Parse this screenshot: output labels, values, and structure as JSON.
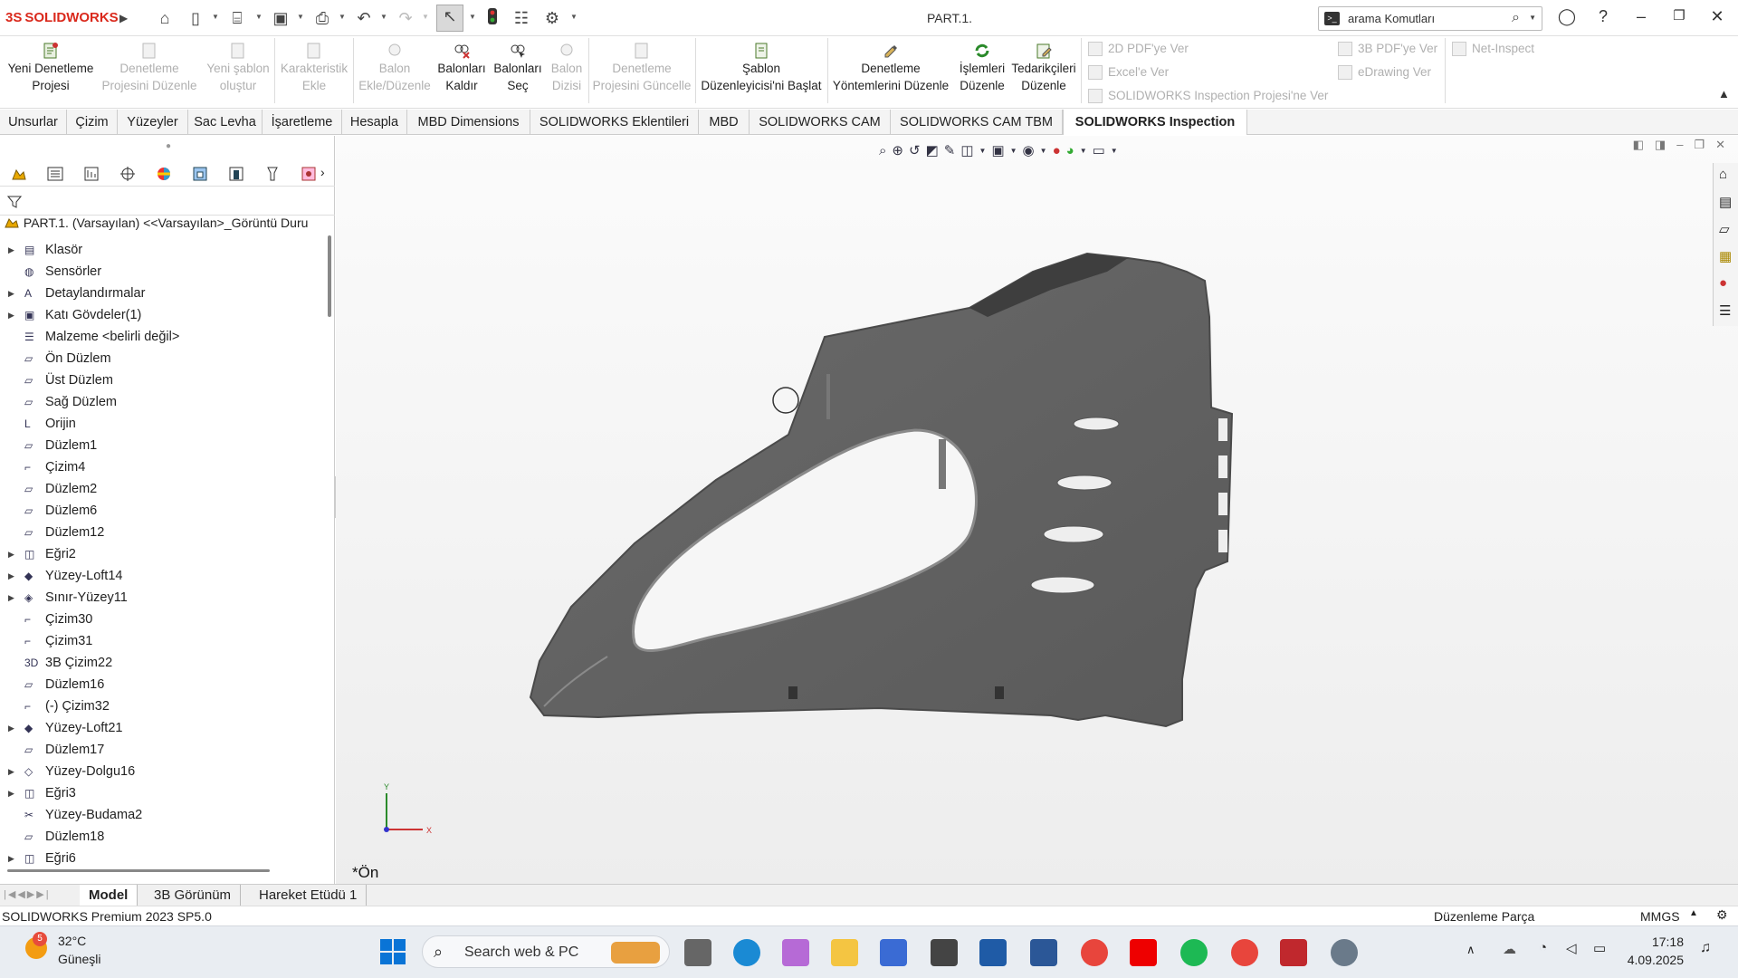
{
  "app": {
    "brand": "SOLIDWORKS",
    "document_title": "PART.1."
  },
  "search": {
    "placeholder": "arama Komutları"
  },
  "ribbon": {
    "buttons": [
      {
        "l1": "Yeni Denetleme",
        "l2": "Projesi",
        "enabled": true
      },
      {
        "l1": "Denetleme",
        "l2": "Projesini Düzenle",
        "enabled": false
      },
      {
        "l1": "Yeni şablon",
        "l2": "oluştur",
        "enabled": false
      },
      {
        "l1": "Karakteristik",
        "l2": "Ekle",
        "enabled": false
      },
      {
        "l1": "Balon",
        "l2": "Ekle/Düzenle",
        "enabled": false
      },
      {
        "l1": "Balonları",
        "l2": "Kaldır",
        "enabled": true
      },
      {
        "l1": "Balonları",
        "l2": "Seç",
        "enabled": true
      },
      {
        "l1": "Balon",
        "l2": "Dizisi",
        "enabled": false
      },
      {
        "l1": "Denetleme",
        "l2": "Projesini Güncelle",
        "enabled": false
      },
      {
        "l1": "Şablon",
        "l2": "Düzenleyicisi'ni Başlat",
        "enabled": true
      },
      {
        "l1": "Denetleme",
        "l2": "Yöntemlerini Düzenle",
        "enabled": true
      },
      {
        "l1": "İşlemleri",
        "l2": "Düzenle",
        "enabled": true
      },
      {
        "l1": "Tedarikçileri",
        "l2": "Düzenle",
        "enabled": true
      }
    ],
    "export_items": [
      "2D PDF'ye Ver",
      "Excel'e Ver",
      "SOLIDWORKS Inspection Projesi'ne Ver",
      "3B PDF'ye Ver",
      "eDrawing Ver",
      "Net-Inspect"
    ]
  },
  "tabs": [
    "Unsurlar",
    "Çizim",
    "Yüzeyler",
    "Sac Levha",
    "İşaretleme",
    "Hesapla",
    "MBD Dimensions",
    "SOLIDWORKS Eklentileri",
    "MBD",
    "SOLIDWORKS CAM",
    "SOLIDWORKS CAM TBM",
    "SOLIDWORKS Inspection"
  ],
  "active_tab": "SOLIDWORKS Inspection",
  "tree": {
    "root": "PART.1. (Varsayılan) <<Varsayılan>_Görüntü Duru",
    "items": [
      {
        "label": "Klasör",
        "icon": "folder-icon",
        "expand": true
      },
      {
        "label": "Sensörler",
        "icon": "sensor-icon",
        "expand": false
      },
      {
        "label": "Detaylandırmalar",
        "icon": "annotation-icon",
        "expand": true
      },
      {
        "label": "Katı Gövdeler(1)",
        "icon": "solid-body-icon",
        "expand": true
      },
      {
        "label": "Malzeme <belirli değil>",
        "icon": "material-icon",
        "expand": false
      },
      {
        "label": "Ön Düzlem",
        "icon": "plane-icon",
        "expand": false
      },
      {
        "label": "Üst Düzlem",
        "icon": "plane-icon",
        "expand": false
      },
      {
        "label": "Sağ Düzlem",
        "icon": "plane-icon",
        "expand": false
      },
      {
        "label": "Orijin",
        "icon": "origin-icon",
        "expand": false
      },
      {
        "label": "Düzlem1",
        "icon": "plane-icon",
        "expand": false
      },
      {
        "label": "Çizim4",
        "icon": "sketch-icon",
        "expand": false
      },
      {
        "label": "Düzlem2",
        "icon": "plane-icon",
        "expand": false
      },
      {
        "label": "Düzlem6",
        "icon": "plane-icon",
        "expand": false
      },
      {
        "label": "Düzlem12",
        "icon": "plane-icon",
        "expand": false
      },
      {
        "label": "Eğri2",
        "icon": "curve-icon",
        "expand": true
      },
      {
        "label": "Yüzey-Loft14",
        "icon": "surface-loft-icon",
        "expand": true
      },
      {
        "label": "Sınır-Yüzey11",
        "icon": "boundary-surface-icon",
        "expand": true
      },
      {
        "label": "Çizim30",
        "icon": "sketch-icon",
        "expand": false
      },
      {
        "label": "Çizim31",
        "icon": "sketch-icon",
        "expand": false
      },
      {
        "label": "3B Çizim22",
        "icon": "3d-sketch-icon",
        "expand": false
      },
      {
        "label": "Düzlem16",
        "icon": "plane-icon",
        "expand": false
      },
      {
        "label": "(-) Çizim32",
        "icon": "sketch-icon",
        "expand": false
      },
      {
        "label": "Yüzey-Loft21",
        "icon": "surface-loft-icon",
        "expand": true
      },
      {
        "label": "Düzlem17",
        "icon": "plane-icon",
        "expand": false
      },
      {
        "label": "Yüzey-Dolgu16",
        "icon": "surface-fill-icon",
        "expand": true
      },
      {
        "label": "Eğri3",
        "icon": "curve-icon",
        "expand": true
      },
      {
        "label": "Yüzey-Budama2",
        "icon": "surface-trim-icon",
        "expand": false
      },
      {
        "label": "Düzlem18",
        "icon": "plane-icon",
        "expand": false
      },
      {
        "label": "Eğri6",
        "icon": "curve-icon",
        "expand": true
      }
    ]
  },
  "viewport": {
    "view_label": "*Ön",
    "axis_x": "X",
    "axis_y": "Y"
  },
  "bottom_tabs": [
    "Model",
    "3B Görünüm",
    "Hareket Etüdü 1"
  ],
  "status": {
    "version": "SOLIDWORKS Premium 2023 SP5.0",
    "mode": "Düzenleme Parça",
    "units": "MMGS"
  },
  "taskbar": {
    "weather_temp": "32°C",
    "weather_desc": "Güneşli",
    "weather_badge": "5",
    "search_text": "Search web & PC",
    "time": "17:18",
    "date": "4.09.2025"
  }
}
